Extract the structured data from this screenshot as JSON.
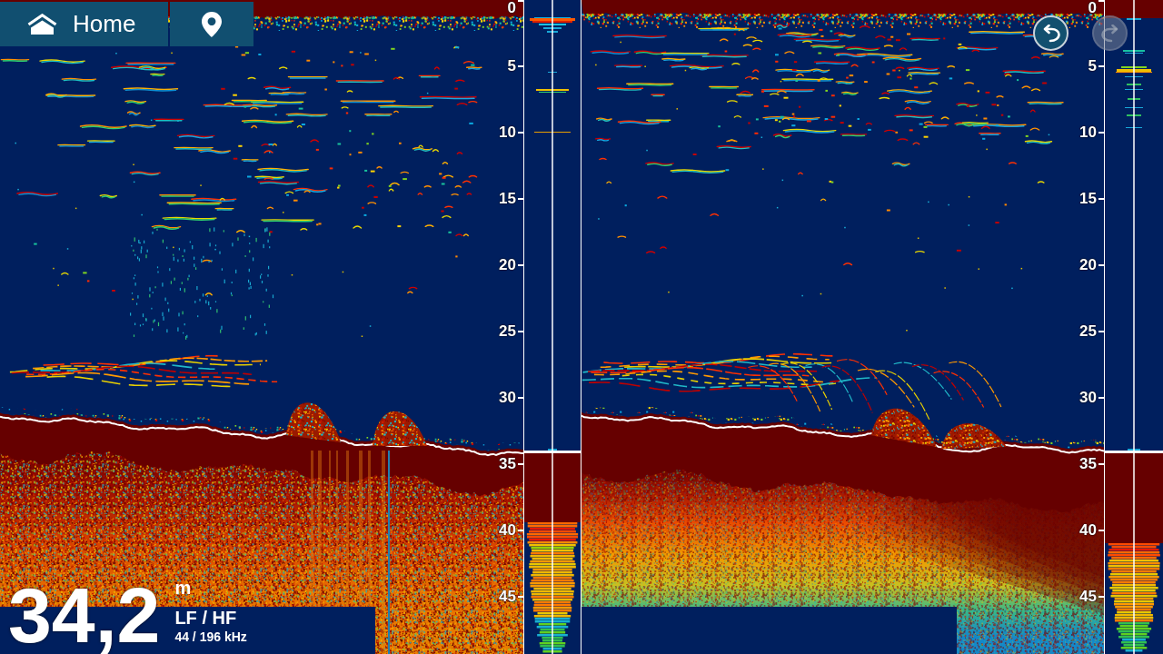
{
  "toolbar": {
    "home_button": {
      "label": "Home"
    }
  },
  "history_buttons": [
    {
      "kind": "undo",
      "disabled": false
    },
    {
      "kind": "redo",
      "disabled": true
    }
  ],
  "panes": [
    {
      "depth_scale": [
        "0",
        "5",
        "10",
        "15",
        "20",
        "25",
        "30",
        "35",
        "40",
        "45"
      ]
    },
    {
      "depth_scale": [
        "0",
        "5",
        "10",
        "15",
        "20",
        "25",
        "30",
        "35",
        "40",
        "45"
      ]
    }
  ],
  "depth_readout": {
    "value": "34,2",
    "unit": "m",
    "frequency_mode": "LF / HF",
    "frequency": "44 / 196 kHz"
  }
}
